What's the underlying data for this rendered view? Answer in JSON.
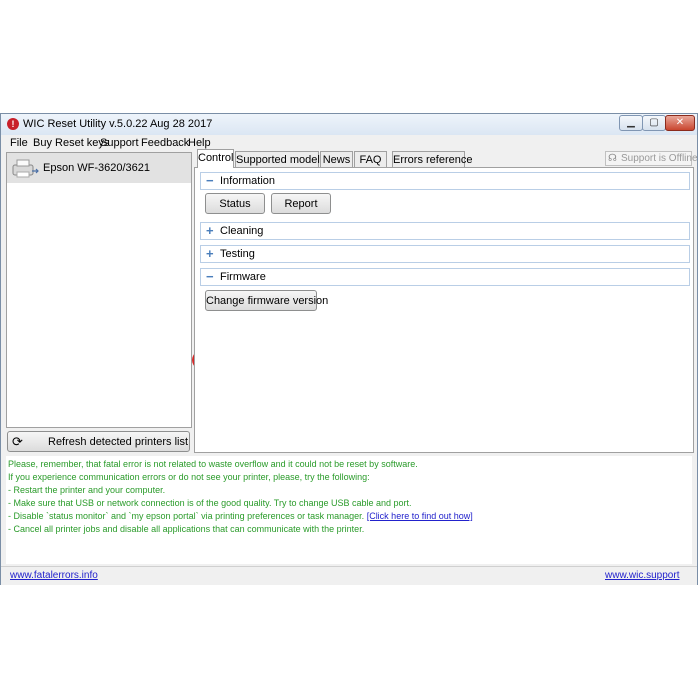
{
  "window": {
    "title": "WIC Reset Utility v.5.0.22 Aug 28 2017",
    "controls": {
      "minimize": "▁",
      "maximize": "▢",
      "close": "✕"
    }
  },
  "menu": [
    "File",
    "Buy Reset keys",
    "Support",
    "Feedback",
    "Help"
  ],
  "printers": {
    "items": [
      {
        "name": "Epson WF-3620/3621",
        "icon": "printer-usb-icon"
      }
    ],
    "refresh_label": "Refresh detected printers list",
    "refresh_icon": "⟳"
  },
  "tabs": [
    {
      "label": "Control",
      "active": true
    },
    {
      "label": "Supported models"
    },
    {
      "label": "News"
    },
    {
      "label": "FAQ"
    },
    {
      "label": "Errors reference"
    }
  ],
  "support_status": {
    "label": "Support is Offline",
    "icon": "headset-icon",
    "glyph": "☊"
  },
  "sections": {
    "information": {
      "sign": "−",
      "label": "Information",
      "buttons": {
        "status": "Status",
        "report": "Report"
      }
    },
    "cleaning": {
      "sign": "+",
      "label": "Cleaning"
    },
    "testing": {
      "sign": "+",
      "label": "Testing"
    },
    "firmware": {
      "sign": "−",
      "label": "Firmware",
      "buttons": {
        "change": "Change firmware version"
      }
    }
  },
  "log": {
    "line1": "Please, remember, that fatal error is not related to waste overflow and it could not be reset by software.",
    "line2": "If you experience communication errors or do not see your printer, please, try the following:",
    "line3": "- Restart the printer and your computer.",
    "line4": "- Make sure that USB or network connection is of the good quality. Try to change USB cable and port.",
    "line5": "- Disable `status monitor` and `my epson portal` via printing preferences or task manager.",
    "line5_link": "[Click here to find out how]",
    "line6": "- Cancel all printer jobs and disable all applications that can communicate with the printer."
  },
  "status_bar": {
    "left_link": "www.fatalerrors.info",
    "right_link": "www.wic.support"
  },
  "colors": {
    "log_text": "#2a9b2a",
    "link": "#2222cc",
    "highlight": "#d62a2a",
    "section_sign": "#4a7ebb"
  }
}
